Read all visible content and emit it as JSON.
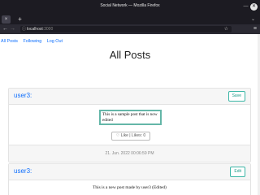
{
  "browser": {
    "window_title": "Social Network — Mozilla Firefox",
    "url_host": "localhost",
    "url_port": ":3000",
    "tab_close": "×",
    "new_tab": "+"
  },
  "nav": {
    "links": [
      "All Posts",
      "Following",
      "Log Out"
    ]
  },
  "page": {
    "title": "All Posts"
  },
  "posts": [
    {
      "user": "user3:",
      "action_label": "Save",
      "edit_text": "This is a sample post that is now edited",
      "like_label": "Like | Likes: 0",
      "timestamp": "21. Jun. 2022 00:06:59 PM"
    },
    {
      "user": "user3:",
      "action_label": "Edit",
      "content": "This is a new post made by user3 (Edited)"
    }
  ]
}
